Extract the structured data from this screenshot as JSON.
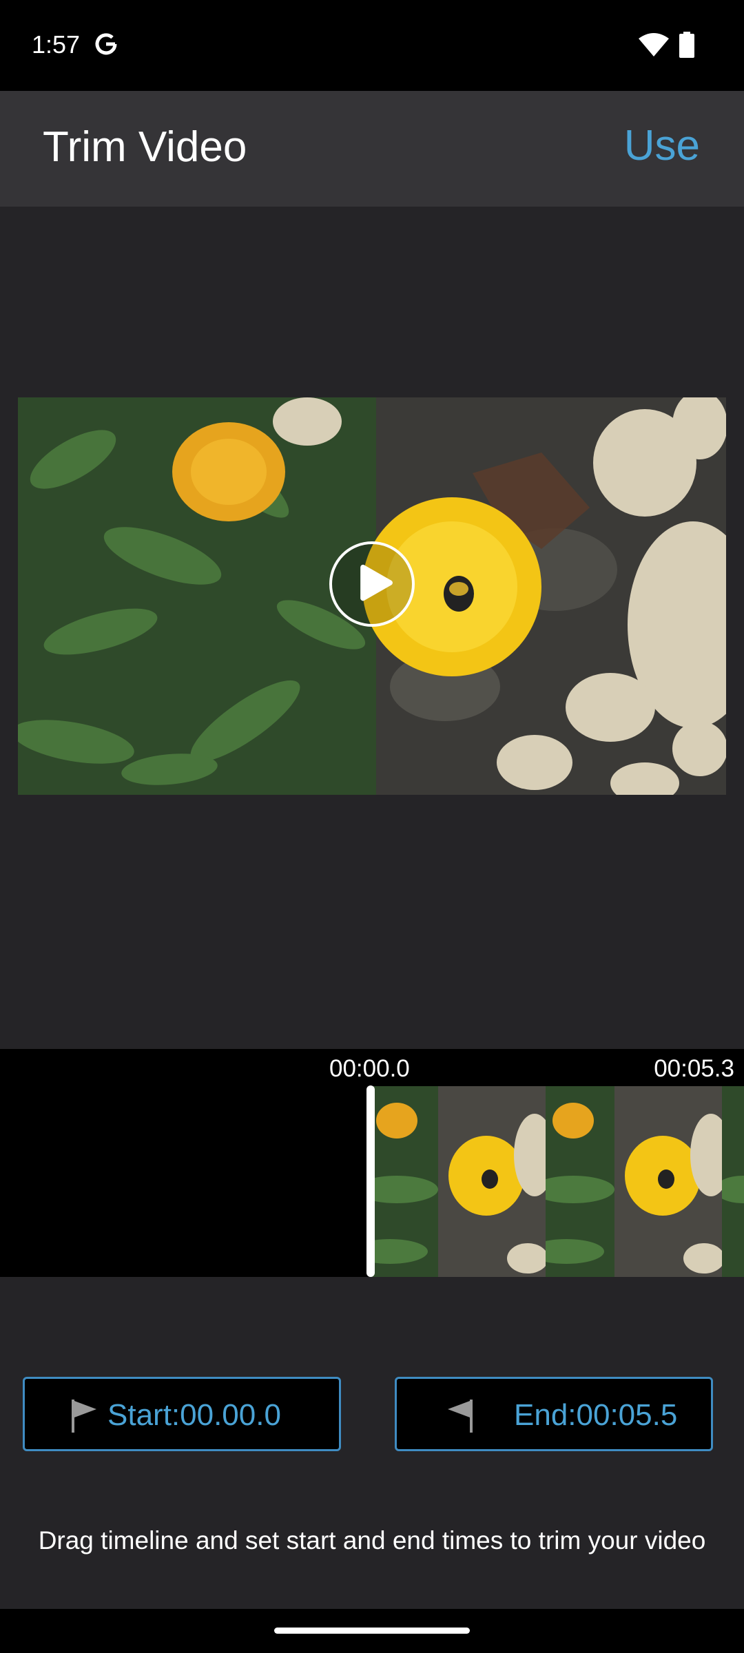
{
  "status_bar": {
    "time": "1:57"
  },
  "app_bar": {
    "title": "Trim Video",
    "use_label": "Use"
  },
  "timeline": {
    "start_time": "00:00.0",
    "end_time": "00:05.3"
  },
  "trim": {
    "start_label": "Start:00.00.0",
    "end_label": "End:00:05.5"
  },
  "hint": "Drag timeline and set start and end times to trim your video",
  "colors": {
    "accent": "#4aa3d6",
    "background": "#252427",
    "app_bar": "#353437"
  },
  "icons": {
    "google": "google-icon",
    "wifi": "wifi-icon",
    "battery": "battery-icon",
    "play": "play-icon",
    "start_flag": "start-flag-icon",
    "end_flag": "end-flag-icon"
  }
}
